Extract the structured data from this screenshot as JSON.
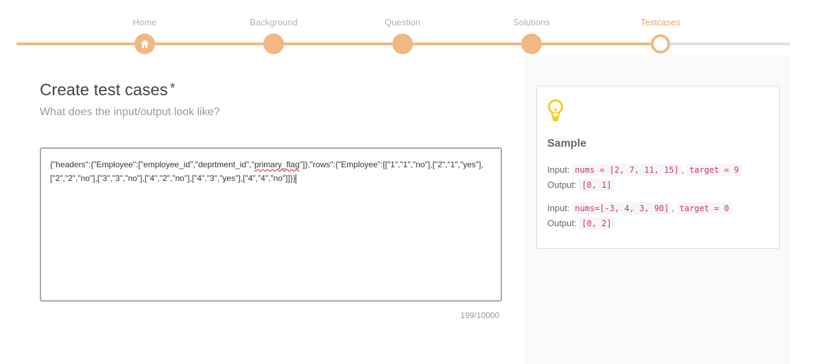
{
  "stepper": {
    "steps": [
      {
        "label": "Home",
        "state": "done",
        "icon": "home-icon"
      },
      {
        "label": "Background",
        "state": "done"
      },
      {
        "label": "Question",
        "state": "done"
      },
      {
        "label": "Solutions",
        "state": "done"
      },
      {
        "label": "Testcases",
        "state": "current"
      }
    ],
    "colors": {
      "done": "#f0b882",
      "active_label": "#f0a35e",
      "pending": "#e0e0e0"
    }
  },
  "main": {
    "title": "Create test cases",
    "required_mark": "*",
    "subtitle": "What does the input/output look like?",
    "editor": {
      "text_before": "{\"headers\":{\"Employee\":[\"employee_id\",\"deprtment_id\",\"",
      "misspelled_word": "primary_flag",
      "text_after": "\"]},\"rows\":{\"Employee\":[[\"1\",\"1\",\"no\"],[\"2\",\"1\",\"yes\"],[\"2\",\"2\",\"no\"],[\"3\",\"3\",\"no\"],[\"4\",\"2\",\"no\"],[\"4\",\"3\",\"yes\"],[\"4\",\"4\",\"no\"]]}}"
    },
    "char_counter": "199/10000"
  },
  "sample": {
    "icon": "lightbulb-icon",
    "title": "Sample",
    "example1": {
      "input_label": "Input:",
      "input_a": "nums = [2, 7, 11, 15]",
      "sep": ",",
      "input_b": "target = 9",
      "output_label": "Output:",
      "output": "[0, 1]"
    },
    "example2": {
      "input_label": "Input:",
      "input_a": "nums=[-3, 4, 3, 90]",
      "sep": ",",
      "input_b": "target = 0",
      "output_label": "Output:",
      "output": "[0, 2]"
    }
  }
}
